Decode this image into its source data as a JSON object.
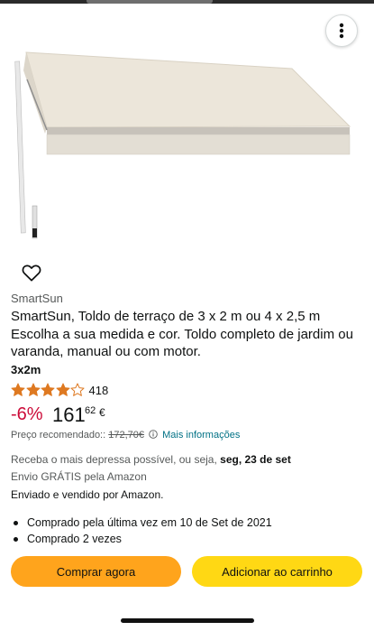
{
  "header": {
    "menu_icon": "more-vertical-icon"
  },
  "product": {
    "brand": "SmartSun",
    "title": "SmartSun, Toldo de terraço de 3 x 2 m ou 4 x 2,5 m Escolha a sua medida e cor. Toldo completo de jardim ou varanda, manual ou com motor.",
    "variant": "3x2m",
    "rating": {
      "stars": 4.0,
      "count": "418"
    },
    "price": {
      "discount": "-6%",
      "integer": "161",
      "decimal": "62",
      "currency": "€",
      "rrp_label": "Preço recomendado::",
      "rrp_value": "172,70€",
      "more_info": "Mais informações"
    },
    "delivery": {
      "text": "Receba o mais depressa possível, ou seja,",
      "date": "seg, 23 de set",
      "shipping": "Envio GRÁTIS pela Amazon",
      "seller": "Enviado e vendido por Amazon."
    },
    "history": [
      "Comprado pela última vez em 10 de Set de 2021",
      "Comprado 2 vezes"
    ]
  },
  "actions": {
    "buy_now": "Comprar agora",
    "add_to_cart": "Adicionar ao carrinho"
  },
  "colors": {
    "buy_now": "#ffa41c",
    "add_to_cart": "#ffd814",
    "discount": "#cc0c39",
    "link": "#007185",
    "star": "#de7921"
  }
}
